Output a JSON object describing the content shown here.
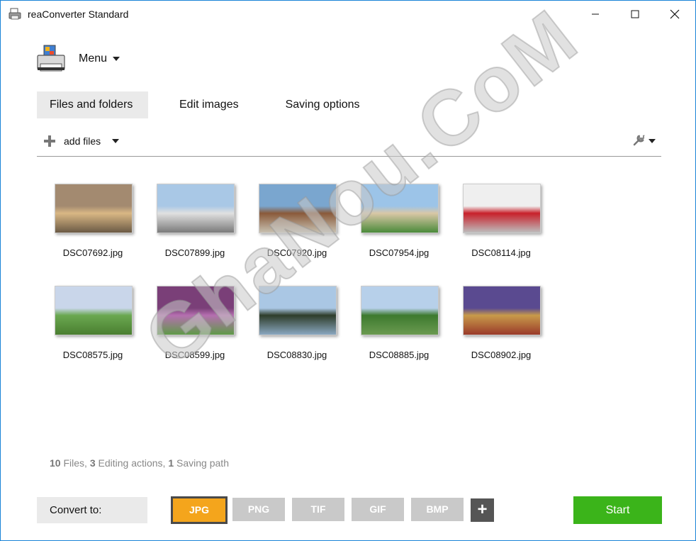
{
  "window": {
    "title": "reaConverter Standard",
    "controls": {
      "minimize": "—",
      "maximize": "☐",
      "close": "✕"
    }
  },
  "menu": {
    "label": "Menu",
    "icon": "printer-icon"
  },
  "tabs": [
    {
      "label": "Files and folders",
      "active": true
    },
    {
      "label": "Edit images",
      "active": false
    },
    {
      "label": "Saving options",
      "active": false
    }
  ],
  "toolbar": {
    "add_files_label": "add files",
    "settings_icon": "wrench-icon"
  },
  "files": [
    {
      "name": "DSC07692.jpg",
      "palette": [
        "#a38a70",
        "#d9b784",
        "#6b5a45"
      ]
    },
    {
      "name": "DSC07899.jpg",
      "palette": [
        "#a9c8e6",
        "#e0e0e0",
        "#7a7a7a"
      ]
    },
    {
      "name": "DSC07920.jpg",
      "palette": [
        "#7aa6cf",
        "#8a5a3a",
        "#c7c0b0"
      ]
    },
    {
      "name": "DSC07954.jpg",
      "palette": [
        "#9cc4e8",
        "#d9c7a6",
        "#4b8a3a"
      ]
    },
    {
      "name": "DSC08114.jpg",
      "palette": [
        "#efefef",
        "#c8202a",
        "#bdbdbd"
      ]
    },
    {
      "name": "DSC08575.jpg",
      "palette": [
        "#c9d6ea",
        "#6aa850",
        "#4a7e30"
      ]
    },
    {
      "name": "DSC08599.jpg",
      "palette": [
        "#7a3f78",
        "#b56fb0",
        "#5f9a48"
      ]
    },
    {
      "name": "DSC08830.jpg",
      "palette": [
        "#aac7e4",
        "#2e3d2a",
        "#8aa7c0"
      ]
    },
    {
      "name": "DSC08885.jpg",
      "palette": [
        "#b7d0ea",
        "#3d7a2f",
        "#6b9a50"
      ]
    },
    {
      "name": "DSC08902.jpg",
      "palette": [
        "#5a4a90",
        "#c89a4a",
        "#9a3a2a"
      ]
    }
  ],
  "status": {
    "files_count": "10",
    "files_label": "Files,",
    "edit_count": "3",
    "edit_label": "Editing actions,",
    "path_count": "1",
    "path_label": "Saving path"
  },
  "convert": {
    "label": "Convert to:",
    "formats": [
      {
        "label": "JPG",
        "active": true
      },
      {
        "label": "PNG",
        "active": false
      },
      {
        "label": "TIF",
        "active": false
      },
      {
        "label": "GIF",
        "active": false
      },
      {
        "label": "BMP",
        "active": false
      }
    ],
    "add_label": "+",
    "start_label": "Start"
  },
  "watermark": "GhaNou.CoM"
}
